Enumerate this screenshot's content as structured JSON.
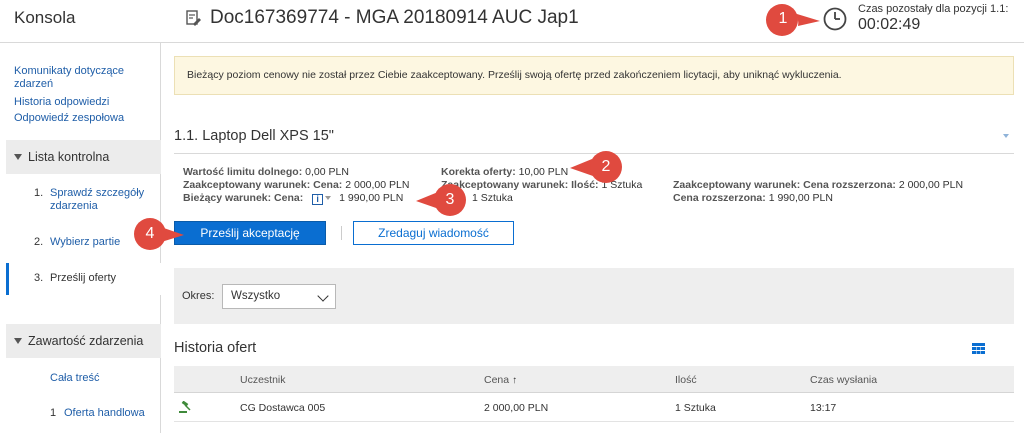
{
  "header": {
    "app_title": "Konsola",
    "doc_title": "Doc167369774 - MGA 20180914 AUC Jap1",
    "time_label": "Czas pozostały dla pozycji 1.1:",
    "time_value": "00:02:49"
  },
  "sidebar": {
    "links": [
      "Komunikaty dotyczące zdarzeń",
      "Historia odpowiedzi",
      "Odpowiedź zespołowa"
    ],
    "checklist_title": "Lista kontrolna",
    "steps": [
      {
        "num": "1.",
        "label": "Sprawdź szczegóły zdarzenia"
      },
      {
        "num": "2.",
        "label": "Wybierz partie"
      },
      {
        "num": "3.",
        "label": "Prześlij oferty"
      }
    ],
    "contents_title": "Zawartość zdarzenia",
    "contents_all": "Cała treść",
    "contents_item_num": "1",
    "contents_item": "Oferta handlowa"
  },
  "banner": {
    "text": "Bieżący poziom cenowy nie został przez Ciebie zaakceptowany. Prześlij swoją ofertę przed zakończeniem licytacji, aby uniknąć wykluczenia."
  },
  "item": {
    "title": "1.1. Laptop Dell XPS 15\"",
    "info": {
      "lower_limit_label": "Wartość limitu dolnego:",
      "lower_limit_value": "0,00 PLN",
      "accepted_price_label": "Zaakceptowany warunek: Cena:",
      "accepted_price_value": "2 000,00 PLN",
      "current_price_label": "Bieżący warunek: Cena:",
      "current_price_value": "1 990,00 PLN",
      "correction_label": "Korekta oferty:",
      "correction_value": "10,00 PLN",
      "accepted_qty_label": "Zaakceptowany warunek: Ilość:",
      "accepted_qty_value": "1 Sztuka",
      "current_qty_value": "1 Sztuka",
      "accepted_ext_label": "Zaakceptowany warunek: Cena rozszerzona:",
      "accepted_ext_value": "2 000,00 PLN",
      "ext_label": "Cena rozszerzona:",
      "ext_value": "1 990,00 PLN"
    },
    "info_icon": "i"
  },
  "buttons": {
    "submit": "Prześlij akceptację",
    "message": "Zredaguj wiadomość"
  },
  "filter": {
    "label": "Okres:",
    "selected": "Wszystko"
  },
  "history": {
    "title": "Historia ofert",
    "columns": [
      "Uczestnik",
      "Cena",
      "Ilość",
      "Czas wysłania"
    ],
    "sort_indicator": "↑",
    "rows": [
      {
        "participant": "CG Dostawca 005",
        "price": "2 000,00 PLN",
        "qty": "1 Sztuka",
        "time": "13:17"
      }
    ]
  },
  "callouts": [
    "1",
    "2",
    "3",
    "4"
  ],
  "colors": {
    "accent": "#0a6ed1",
    "callout": "#e04a3f",
    "banner_bg": "#fdf7e1"
  }
}
